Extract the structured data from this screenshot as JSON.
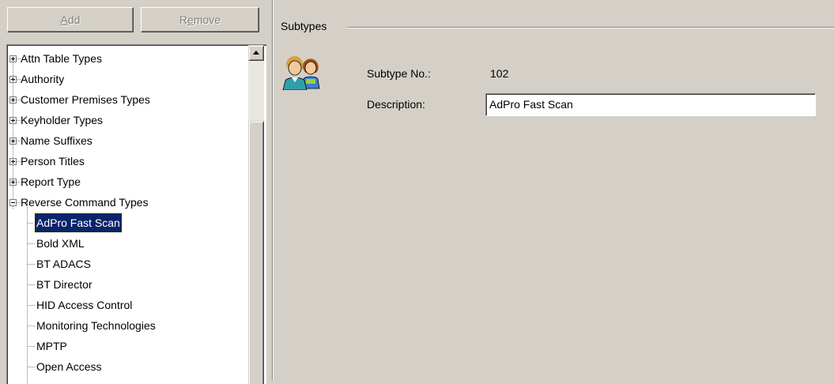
{
  "toolbar": {
    "add_prefix": "",
    "add_accel": "A",
    "add_suffix": "dd",
    "remove_prefix": "R",
    "remove_accel": "e",
    "remove_suffix": "move"
  },
  "tree": {
    "parents": [
      {
        "label": "Attn Table Types",
        "expanded": false
      },
      {
        "label": "Authority",
        "expanded": false
      },
      {
        "label": "Customer Premises Types",
        "expanded": false
      },
      {
        "label": "Keyholder Types",
        "expanded": false
      },
      {
        "label": "Name Suffixes",
        "expanded": false
      },
      {
        "label": "Person Titles",
        "expanded": false
      },
      {
        "label": "Report Type",
        "expanded": false
      },
      {
        "label": "Reverse Command Types",
        "expanded": true
      }
    ],
    "children": [
      {
        "label": "AdPro Fast Scan",
        "selected": true
      },
      {
        "label": "Bold XML",
        "selected": false
      },
      {
        "label": "BT ADACS",
        "selected": false
      },
      {
        "label": "BT Director",
        "selected": false
      },
      {
        "label": "HID Access Control",
        "selected": false
      },
      {
        "label": "Monitoring Technologies",
        "selected": false
      },
      {
        "label": "MPTP",
        "selected": false
      },
      {
        "label": "Open Access",
        "selected": false
      }
    ]
  },
  "group": {
    "title": "Subtypes",
    "icon": "users-icon"
  },
  "form": {
    "subtype_no_label": "Subtype No.:",
    "subtype_no_value": "102",
    "description_label": "Description:",
    "description_value": "AdPro Fast Scan"
  },
  "colors": {
    "selection": "#0a246a",
    "face": "#d4d0c8"
  }
}
